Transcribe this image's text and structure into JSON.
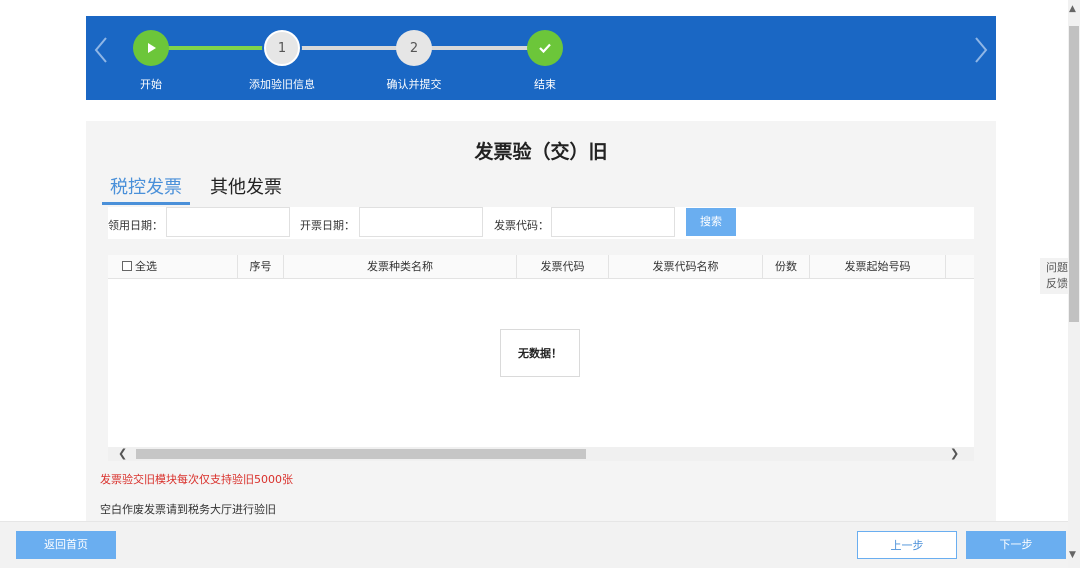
{
  "wizard": {
    "steps": [
      {
        "label": "开始",
        "status": "done",
        "icon": "play-icon"
      },
      {
        "label": "添加验旧信息",
        "status": "current",
        "number": "1"
      },
      {
        "label": "确认并提交",
        "status": "todo",
        "number": "2"
      },
      {
        "label": "结束",
        "status": "done",
        "icon": "check-icon"
      }
    ],
    "colors": {
      "bar": "#1a67c4",
      "done": "#6cc63a",
      "todo": "#e6e6e6"
    }
  },
  "page": {
    "title": "发票验（交）旧"
  },
  "tabs": [
    {
      "label": "税控发票",
      "active": true
    },
    {
      "label": "其他发票",
      "active": false
    }
  ],
  "search": {
    "receive_date_label": "领用日期：",
    "receive_date_value": "",
    "issue_date_label": "开票日期：",
    "issue_date_value": "",
    "invoice_code_label": "发票代码：",
    "invoice_code_value": "",
    "search_button": "搜索"
  },
  "table": {
    "columns": [
      "全选",
      "序号",
      "发票种类名称",
      "发票代码",
      "发票代码名称",
      "份数",
      "发票起始号码"
    ],
    "rows": [],
    "empty_message": "无数据！"
  },
  "notes": {
    "limit": "发票验交旧模块每次仅支持验旧5000张",
    "blank": "空白作废发票请到税务大厅进行验旧"
  },
  "feedback": {
    "line1": "问题",
    "line2": "反馈"
  },
  "footer": {
    "home": "返回首页",
    "prev": "上一步",
    "next": "下一步"
  }
}
